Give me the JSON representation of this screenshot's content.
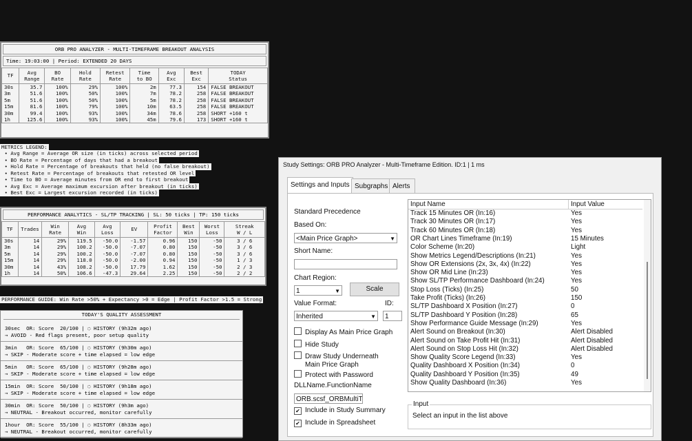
{
  "orb": {
    "title": "ORB PRO ANALYZER - MULTI-TIMEFRAME BREAKOUT ANALYSIS",
    "info": "Time: 19:03:00   |   Period: EXTENDED 20 DAYS",
    "headers": [
      [
        "TF",
        ""
      ],
      [
        "Avg",
        "Range"
      ],
      [
        "BO",
        "Rate"
      ],
      [
        "Hold",
        "Rate"
      ],
      [
        "Retest",
        "Rate"
      ],
      [
        "Time",
        "to BO"
      ],
      [
        "Avg",
        "Exc"
      ],
      [
        "Best",
        "Exc"
      ],
      [
        "TODAY",
        "Status"
      ]
    ],
    "rows": [
      [
        "30s",
        "35.7",
        "100%",
        "29%",
        "100%",
        "2m",
        "77.3",
        "154",
        "FALSE BREAKOUT"
      ],
      [
        "3m",
        "51.6",
        "100%",
        "50%",
        "100%",
        "7m",
        "78.2",
        "258",
        "FALSE BREAKOUT"
      ],
      [
        "5m",
        "51.6",
        "100%",
        "50%",
        "100%",
        "5m",
        "78.2",
        "258",
        "FALSE BREAKOUT"
      ],
      [
        "15m",
        "81.6",
        "100%",
        "79%",
        "100%",
        "10m",
        "63.5",
        "258",
        "FALSE BREAKOUT"
      ],
      [
        "30m",
        "99.4",
        "100%",
        "93%",
        "100%",
        "34m",
        "78.6",
        "258",
        "SHORT +160   t"
      ],
      [
        "1h",
        "125.6",
        "100%",
        "93%",
        "100%",
        "45m",
        "79.6",
        "173",
        "SHORT +160   t"
      ]
    ]
  },
  "legend": {
    "title": "METRICS LEGEND:",
    "items": [
      " • Avg Range = Average OR size (in ticks) across selected period",
      " • BO Rate = Percentage of days that had a breakout",
      " • Hold Rate = Percentage of breakouts that held (no false breakout)",
      " • Retest Rate = Percentage of breakouts that retested OR level",
      " • Time to BO = Average minutes from OR end to first breakout",
      " • Avg Exc = Average maximum excursion after breakout (in ticks)",
      " • Best Exc = Largest excursion recorded (in ticks)"
    ]
  },
  "perf": {
    "title": "PERFORMANCE ANALYTICS - SL/TP TRACKING  | SL: 50  ticks | TP: 150 ticks",
    "headers": [
      [
        "TF",
        ""
      ],
      [
        "Trades",
        ""
      ],
      [
        "Win",
        "Rate"
      ],
      [
        "Avg",
        "Win"
      ],
      [
        "Avg",
        "Loss"
      ],
      [
        "EV",
        ""
      ],
      [
        "Profit",
        "Factor"
      ],
      [
        "Best",
        "Win"
      ],
      [
        "Worst",
        "Loss"
      ],
      [
        "Streak",
        "W / L"
      ]
    ],
    "rows": [
      [
        "30s",
        "14",
        "29%",
        "119.5",
        "-50.0",
        "-1.57",
        "0.96",
        "150",
        "-50",
        "3 / 6"
      ],
      [
        "3m",
        "14",
        "29%",
        "100.2",
        "-50.0",
        "-7.07",
        "0.80",
        "150",
        "-50",
        "3 / 6"
      ],
      [
        "5m",
        "14",
        "29%",
        "100.2",
        "-50.0",
        "-7.07",
        "0.80",
        "150",
        "-50",
        "3 / 6"
      ],
      [
        "15m",
        "14",
        "29%",
        "118.0",
        "-50.0",
        "-2.00",
        "0.94",
        "150",
        "-50",
        "1 / 3"
      ],
      [
        "30m",
        "14",
        "43%",
        "108.2",
        "-50.0",
        "17.79",
        "1.62",
        "150",
        "-50",
        "2 / 3"
      ],
      [
        "1h",
        "14",
        "50%",
        "106.6",
        "-47.3",
        "29.64",
        "2.25",
        "150",
        "-50",
        "2 / 2"
      ]
    ],
    "guide": "PERFORMANCE GUIDE: Win Rate >50% + Expectancy >0 = Edge | Profit Factor >1.5 = Strong"
  },
  "quality": {
    "title": "TODAY'S QUALITY ASSESSMENT",
    "items": [
      {
        "line1": "30sec  OR: Score  20/100 | ◌ HISTORY (9h32m ago)",
        "line2": "→ AVOID - Red flags present, poor setup quality"
      },
      {
        "line1": "3min   OR: Score  65/100 | ◌ HISTORY (9h30m ago)",
        "line2": "→ SKIP - Moderate score + time elapsed = low edge"
      },
      {
        "line1": "5min   OR: Score  65/100 | ◌ HISTORY (9h28m ago)",
        "line2": "→ SKIP - Moderate score + time elapsed = low edge"
      },
      {
        "line1": "15min  OR: Score  50/100 | ◌ HISTORY (9h18m ago)",
        "line2": "→ SKIP - Moderate score + time elapsed = low edge"
      },
      {
        "line1": "30min  OR: Score  50/100 | ◌ HISTORY (9h3m ago)",
        "line2": "→ NEUTRAL - Breakout occurred, monitor carefully"
      },
      {
        "line1": "1hour  OR: Score  55/100 | ◌ HISTORY (8h33m ago)",
        "line2": "→ NEUTRAL - Breakout occurred, monitor carefully"
      }
    ]
  },
  "dialog": {
    "title": "Study Settings: ORB PRO Analyzer - Multi-Timeframe Edition. ID:1 | 1 ms",
    "tabs": [
      "Settings and Inputs",
      "Subgraphs",
      "Alerts"
    ],
    "standard_precedence": "Standard Precedence",
    "based_on_label": "Based On:",
    "based_on_value": "<Main Price Graph>",
    "short_name_label": "Short Name:",
    "short_name_value": "",
    "chart_region_label": "Chart Region:",
    "chart_region_value": "1",
    "scale_button": "Scale",
    "value_format_label": "Value Format:",
    "value_format_value": "Inherited",
    "id_label": "ID:",
    "id_value": "1",
    "checkboxes": [
      {
        "label": "Display As Main Price Graph",
        "checked": false
      },
      {
        "label": "Hide Study",
        "checked": false
      },
      {
        "label": "Draw Study Underneath",
        "label2": "Main Price Graph",
        "checked": false
      },
      {
        "label": "Protect with Password",
        "checked": false
      }
    ],
    "dll_label": "DLLName.FunctionName",
    "dll_value": "ORB.scsf_ORBMultiTir",
    "include_summary": "Include in Study Summary",
    "include_spreadsheet": "Include in Spreadsheet",
    "grid_headers": [
      "Input Name",
      "Input Value"
    ],
    "inputs": [
      [
        "Track 15 Minutes OR  (In:16)",
        "Yes"
      ],
      [
        "Track 30 Minutes OR  (In:17)",
        "Yes"
      ],
      [
        "Track 60 Minutes OR  (In:18)",
        "Yes"
      ],
      [
        "OR Chart Lines Timeframe  (In:19)",
        "15 Minutes"
      ],
      [
        "Color Scheme  (In:20)",
        "Light"
      ],
      [
        "Show Metrics Legend/Descriptions  (In:21)",
        "Yes"
      ],
      [
        "Show OR Extensions (2x, 3x, 4x)  (In:22)",
        "Yes"
      ],
      [
        "Show OR Mid Line  (In:23)",
        "Yes"
      ],
      [
        "Show SL/TP Performance Dashboard  (In:24)",
        "Yes"
      ],
      [
        "Stop Loss (Ticks)  (In:25)",
        "50"
      ],
      [
        "Take Profit (Ticks)  (In:26)",
        "150"
      ],
      [
        "SL/TP Dashboard X Position  (In:27)",
        "0"
      ],
      [
        "SL/TP Dashboard Y Position  (In:28)",
        "65"
      ],
      [
        "Show Performance Guide Message  (In:29)",
        "Yes"
      ],
      [
        "Alert Sound on Breakout  (In:30)",
        "Alert Disabled"
      ],
      [
        "Alert Sound on Take Profit Hit  (In:31)",
        "Alert Disabled"
      ],
      [
        "Alert Sound on Stop Loss Hit  (In:32)",
        "Alert Disabled"
      ],
      [
        "Show Quality Score Legend  (In:33)",
        "Yes"
      ],
      [
        "Quality Dashboard X Position  (In:34)",
        "0"
      ],
      [
        "Quality Dashboard Y Position  (In:35)",
        "49"
      ],
      [
        "Show Quality Dashboard  (In:36)",
        "Yes"
      ]
    ],
    "input_group_label": "Input",
    "input_hint": "Select an input in the list above"
  }
}
